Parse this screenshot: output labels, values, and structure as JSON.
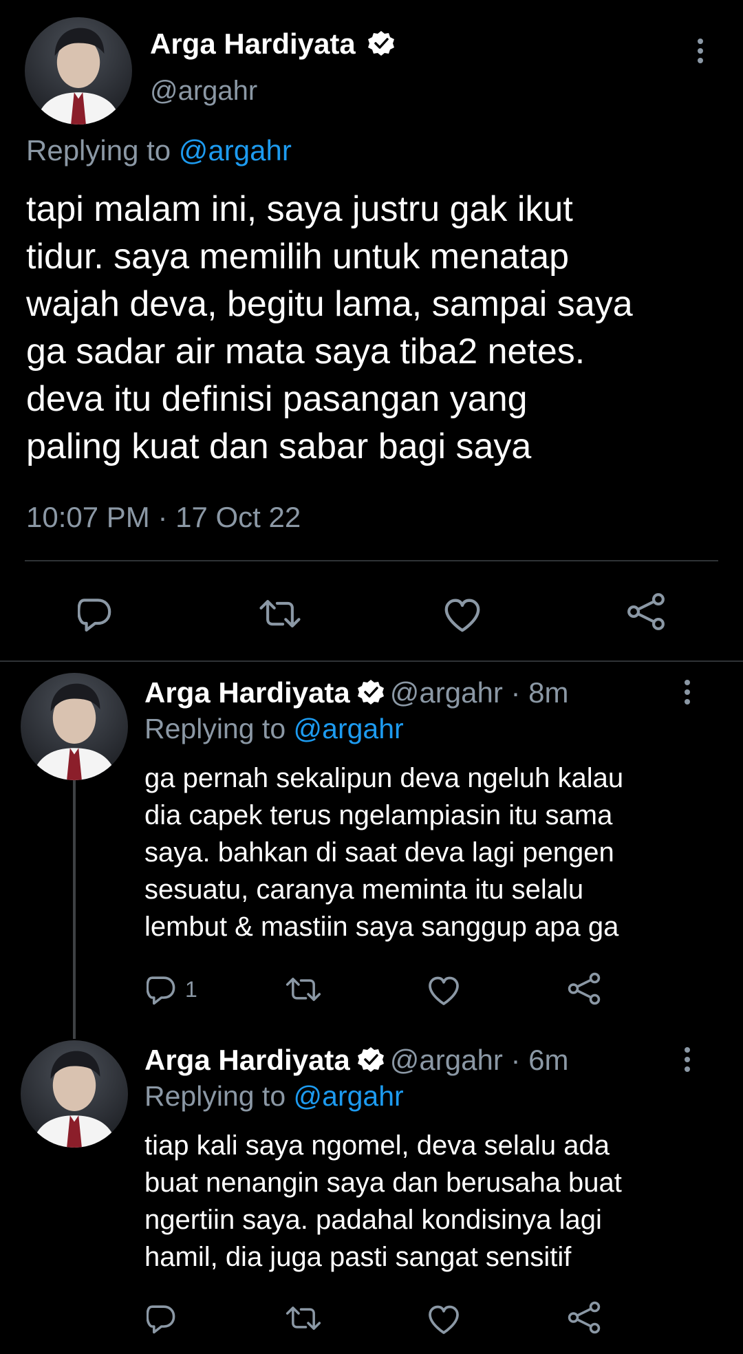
{
  "main_tweet": {
    "name": "Arga Hardiyata",
    "handle": "@argahr",
    "replying_prefix": "Replying to",
    "replying_to": "@argahr",
    "text": "tapi malam ini, saya justru gak ikut\ntidur. saya memilih untuk menatap\nwajah deva, begitu lama, sampai saya\nga sadar air mata saya tiba2 netes.\ndeva itu definisi pasangan yang\npaling kuat dan sabar bagi saya",
    "timestamp": "10:07 PM · 17 Oct 22"
  },
  "replies": [
    {
      "name": "Arga Hardiyata",
      "handle": "@argahr",
      "time": "· 8m",
      "replying_prefix": "Replying to",
      "replying_to": "@argahr",
      "text": "ga pernah sekalipun deva ngeluh kalau\ndia capek terus ngelampiasin itu sama\nsaya. bahkan di saat deva lagi pengen\nsesuatu, caranya meminta itu selalu\nlembut & mastiin saya sanggup apa ga",
      "reply_count": "1"
    },
    {
      "name": "Arga Hardiyata",
      "handle": "@argahr",
      "time": "· 6m",
      "replying_prefix": "Replying to",
      "replying_to": "@argahr",
      "text": "tiap kali saya ngomel, deva selalu ada\nbuat nenangin saya dan berusaha buat\nngertiin saya. padahal kondisinya lagi\nhamil, dia juga pasti sangat sensitif",
      "reply_count": ""
    }
  ],
  "icons": [
    "reply-icon",
    "retweet-icon",
    "like-icon",
    "share-icon",
    "verified-icon",
    "more-icon"
  ],
  "colors": {
    "background": "#000000",
    "link": "#1d9bf0",
    "muted": "#8b98a5",
    "text": "#ffffff"
  }
}
